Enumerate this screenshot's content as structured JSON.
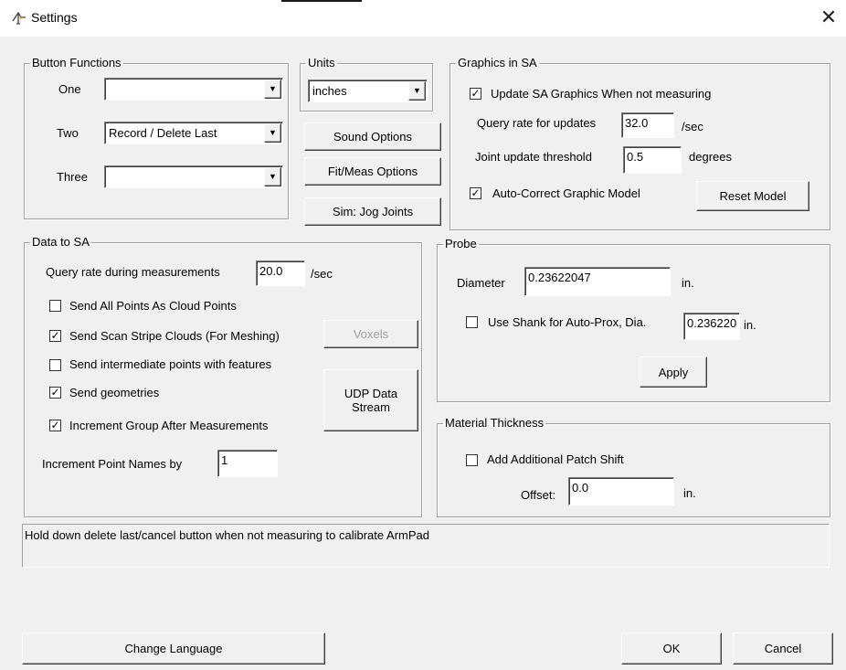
{
  "window": {
    "title": "Settings",
    "close_glyph": "✕"
  },
  "button_functions": {
    "legend": "Button Functions",
    "one_label": "One",
    "one_value": "",
    "two_label": "Two",
    "two_value": "Record / Delete Last",
    "three_label": "Three",
    "three_value": ""
  },
  "units": {
    "legend": "Units",
    "value": "inches"
  },
  "mid_buttons": {
    "sound": "Sound Options",
    "fit_meas": "Fit/Meas Options",
    "sim_jog": "Sim: Jog Joints"
  },
  "graphics": {
    "legend": "Graphics in SA",
    "update_label": "Update SA Graphics When not measuring",
    "update_checked": true,
    "query_rate_label": "Query rate for updates",
    "query_rate_value": "32.0",
    "query_rate_unit": "/sec",
    "joint_label": "Joint update threshold",
    "joint_value": "0.5",
    "joint_unit": "degrees",
    "autocorrect_label": "Auto-Correct Graphic Model",
    "autocorrect_checked": true,
    "reset_button": "Reset Model"
  },
  "data_to_sa": {
    "legend": "Data to SA",
    "query_label": "Query rate during measurements",
    "query_value": "20.0",
    "query_unit": "/sec",
    "cloud_points_label": "Send All Points As Cloud Points",
    "cloud_points_checked": false,
    "scan_stripe_label": "Send Scan Stripe Clouds (For Meshing)",
    "scan_stripe_checked": true,
    "voxels_button": "Voxels",
    "intermediate_label": "Send intermediate points with features",
    "intermediate_checked": false,
    "geometries_label": "Send geometries",
    "geometries_checked": true,
    "udp_button": "UDP Data Stream",
    "increment_group_label": "Increment Group After Measurements",
    "increment_group_checked": true,
    "increment_names_label": "Increment Point Names by",
    "increment_names_value": "1"
  },
  "probe": {
    "legend": "Probe",
    "diameter_label": "Diameter",
    "diameter_value": "0.23622047",
    "diameter_unit": "in.",
    "shank_label": "Use Shank for Auto-Prox, Dia.",
    "shank_checked": false,
    "shank_value": "0.236220",
    "shank_unit": "in.",
    "apply_button": "Apply"
  },
  "material": {
    "legend": "Material Thickness",
    "patch_label": "Add Additional Patch Shift",
    "patch_checked": false,
    "offset_label": "Offset:",
    "offset_value": "0.0",
    "offset_unit": "in."
  },
  "status_text": "Hold down delete last/cancel button when not measuring to calibrate ArmPad",
  "footer": {
    "change_language": "Change Language",
    "ok": "OK",
    "cancel": "Cancel"
  },
  "icons": {
    "app": "settings-app-icon",
    "dropdown": "chevron-down-icon",
    "check": "checkmark-icon",
    "close": "close-icon"
  }
}
